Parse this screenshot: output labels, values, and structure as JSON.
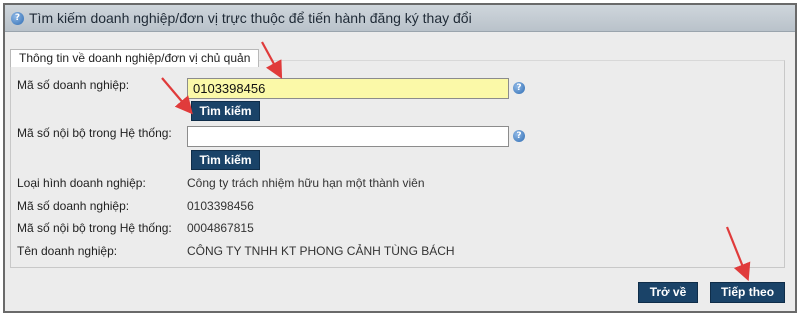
{
  "header": {
    "title": "Tìm kiếm doanh nghiệp/đơn vị trực thuộc để tiến hành đăng ký thay đổi",
    "help_icon": "question-circle-icon"
  },
  "tab": {
    "label": "Thông tin về doanh nghiệp/đơn vị chủ quản"
  },
  "form": {
    "business_code_label": "Mã số doanh nghiệp:",
    "business_code_value": "0103398456",
    "search_button_1": "Tìm kiếm",
    "internal_code_label": "Mã số nội bộ trong Hệ thống:",
    "internal_code_value": "",
    "search_button_2": "Tìm kiếm"
  },
  "details": {
    "type_label": "Loại hình doanh nghiệp:",
    "type_value": "Công ty trách nhiệm hữu hạn một thành viên",
    "code_label": "Mã số doanh nghiệp:",
    "code_value": "0103398456",
    "internal_label": "Mã số nội bộ trong Hệ thống:",
    "internal_value": "0004867815",
    "name_label": "Tên doanh nghiệp:",
    "name_value": "CÔNG TY TNHH KT PHONG CẢNH TÙNG BÁCH"
  },
  "footer": {
    "back_label": "Trở về",
    "next_label": "Tiếp theo"
  },
  "colors": {
    "button_bg": "#1a4368",
    "input_highlight": "#fbf9a8",
    "annotation_arrow": "#e03b3b"
  }
}
